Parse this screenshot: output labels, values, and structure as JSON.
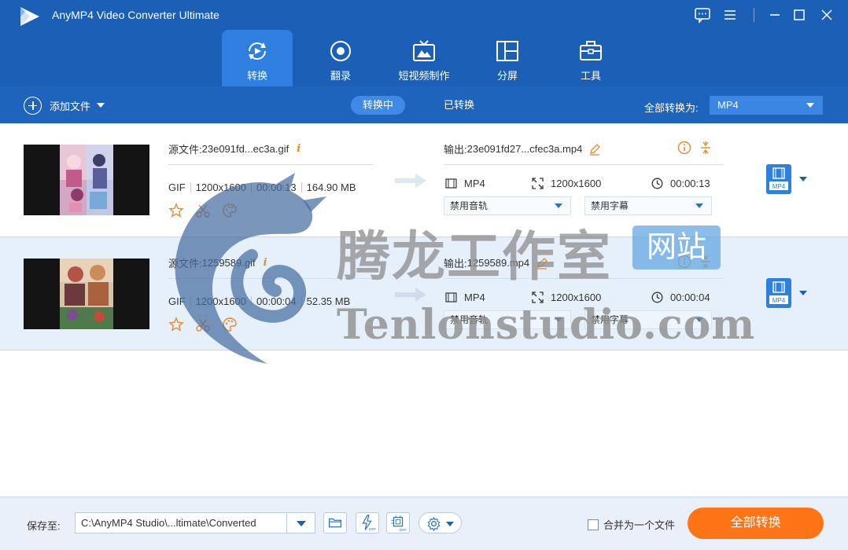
{
  "window": {
    "title": "AnyMP4 Video Converter Ultimate",
    "logo_icon": "play-triangle-logo",
    "controls": [
      "feedback-icon",
      "menu-icon",
      "minimize-icon",
      "maximize-icon",
      "close-icon"
    ]
  },
  "nav": {
    "tabs": [
      {
        "label": "转换",
        "icon": "convert-icon",
        "active": true
      },
      {
        "label": "翻录",
        "icon": "disc-icon",
        "active": false
      },
      {
        "label": "短视频制作",
        "icon": "tv-icon",
        "active": false
      },
      {
        "label": "分屏",
        "icon": "split-screen-icon",
        "active": false
      },
      {
        "label": "工具",
        "icon": "toolbox-icon",
        "active": false
      }
    ]
  },
  "toolbar": {
    "add_file_label": "添加文件",
    "tabs": [
      {
        "label": "转换中",
        "active": true
      },
      {
        "label": "已转换",
        "active": false
      }
    ],
    "convert_all_to_label": "全部转换为:",
    "convert_all_format": "MP4"
  },
  "files": [
    {
      "source_label": "源文件:",
      "source_name": "23e091fd...ec3a.gif",
      "format": "GIF",
      "resolution": "1200x1600",
      "duration": "00:00:13",
      "size": "164.90 MB",
      "output_label": "输出:",
      "output_name": "23e091fd27...cfec3a.mp4",
      "out_format": "MP4",
      "out_resolution": "1200x1600",
      "out_duration": "00:00:13",
      "audio_select": "禁用音轨",
      "subtitle_select": "禁用字幕",
      "badge_format": "MP4"
    },
    {
      "source_label": "源文件:",
      "source_name": "1259589.gif",
      "format": "GIF",
      "resolution": "1200x1600",
      "duration": "00:00:04",
      "size": "52.35 MB",
      "output_label": "输出:",
      "output_name": "1259589.mp4",
      "out_format": "MP4",
      "out_resolution": "1200x1600",
      "out_duration": "00:00:04",
      "audio_select": "禁用音轨",
      "subtitle_select": "禁用字幕",
      "badge_format": "MP4"
    }
  ],
  "watermark": {
    "cn_text": "腾龙工作室",
    "badge_text": "网站",
    "en_text": "Tenlonstudio.com"
  },
  "footer": {
    "save_to_label": "保存至:",
    "save_path": "C:\\AnyMP4 Studio\\...ltimate\\Converted",
    "merge_label": "合并为一个文件",
    "merge_checked": false,
    "convert_all_button": "全部转换"
  },
  "colors": {
    "header": "#1b5fb6",
    "active_tab": "#2f7fe0",
    "accent_orange": "#ff7417",
    "info_orange": "#e8892b"
  }
}
